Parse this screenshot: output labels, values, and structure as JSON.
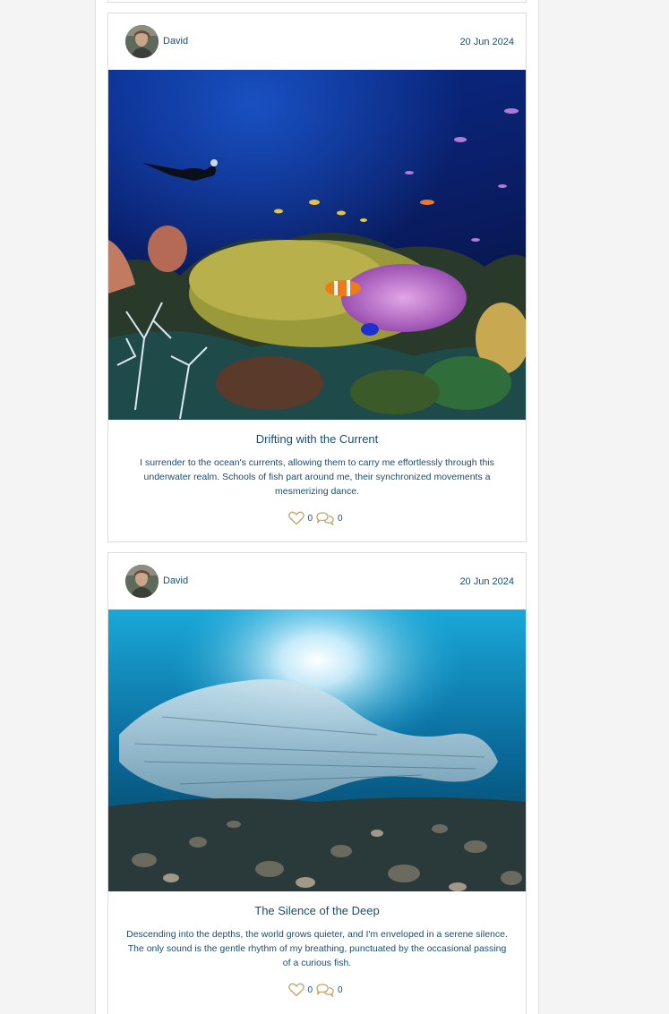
{
  "posts": [
    {
      "author": "David",
      "date": "20 Jun 2024",
      "title": "Drifting with the Current",
      "excerpt": "I surrender to the ocean's currents, allowing them to carry me effortlessly through this underwater realm. Schools of fish part around me, their synchronized movements a mesmerizing dance.",
      "likes": "0",
      "comments": "0",
      "image_alt": "Diver above coral reef with clownfish in anemone"
    },
    {
      "author": "David",
      "date": "20 Jun 2024",
      "title": "The Silence of the Deep",
      "excerpt": "Descending into the depths, the world grows quieter, and I'm enveloped in a serene silence. The only sound is the gentle rhythm of my breathing, punctuated by the occasional passing of a curious fish.",
      "likes": "0",
      "comments": "0",
      "image_alt": "School of fish under sunlit water above rocky seabed"
    }
  ],
  "colors": {
    "text": "#1a4d6e",
    "icon": "#c9a46a",
    "border": "#dcdcdc"
  },
  "icons": {
    "like": "heart-icon",
    "comment": "speech-bubbles-icon"
  }
}
